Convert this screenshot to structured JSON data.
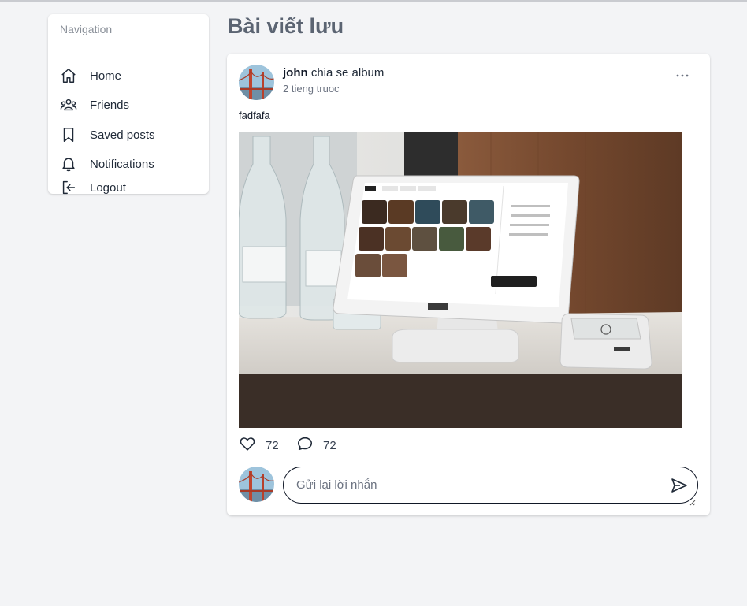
{
  "sidebar": {
    "title": "Navigation",
    "items": [
      {
        "label": "Home",
        "icon": "home-icon"
      },
      {
        "label": "Friends",
        "icon": "users-icon"
      },
      {
        "label": "Saved posts",
        "icon": "bookmark-icon"
      },
      {
        "label": "Notifications",
        "icon": "bell-icon"
      },
      {
        "label": "Logout",
        "icon": "logout-icon"
      }
    ]
  },
  "page": {
    "title": "Bài viết lưu"
  },
  "post": {
    "author": "john",
    "action_text": " chia se album",
    "time": "2 tieng truoc",
    "caption": "fadfafa",
    "image_subject": "POS tablet on counter",
    "likes": "72",
    "comments": "72"
  },
  "reply": {
    "placeholder": "Gửi lại lời nhắn",
    "value": ""
  },
  "colors": {
    "background": "#f3f4f6",
    "card": "#ffffff",
    "title": "#5b6472",
    "muted": "#8a9099"
  }
}
